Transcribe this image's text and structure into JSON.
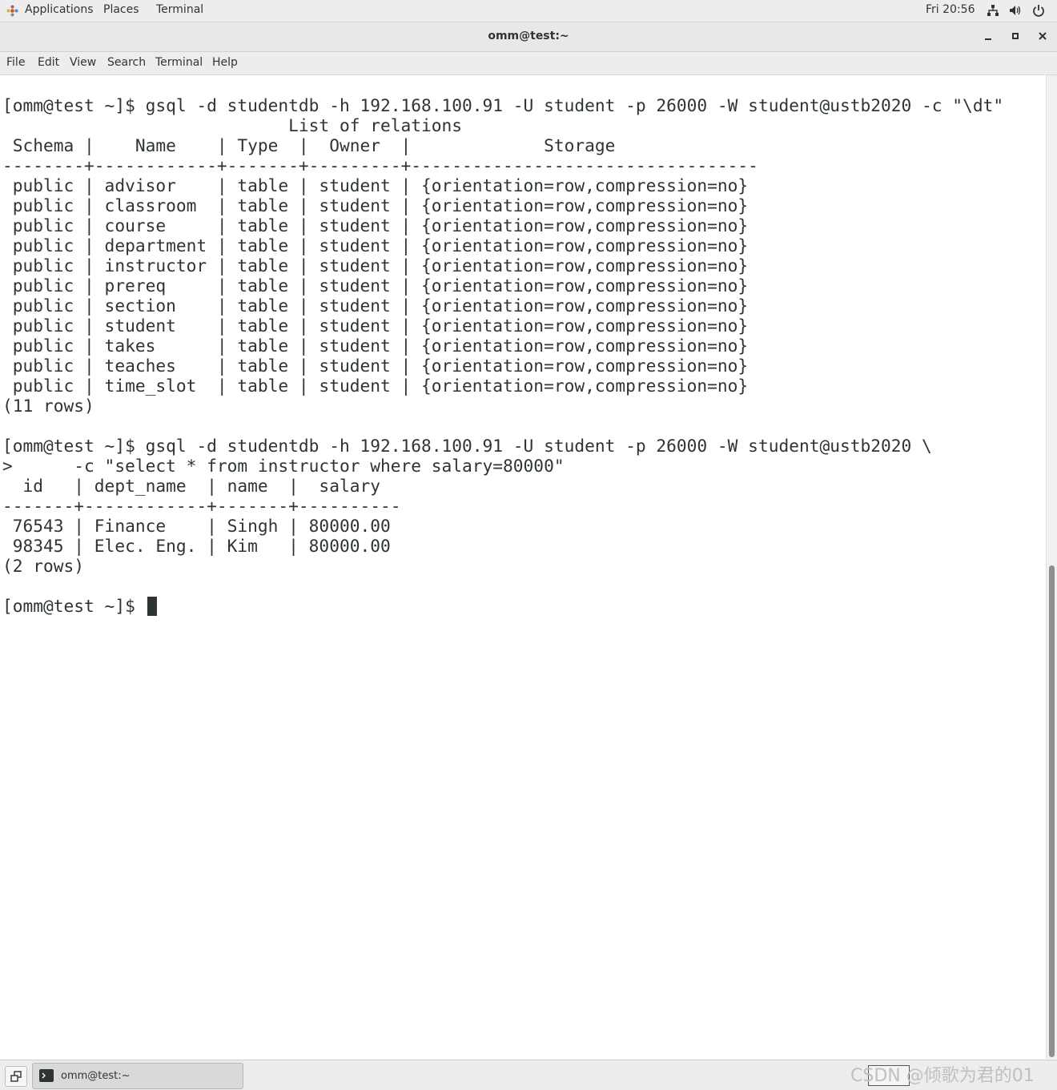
{
  "top_panel": {
    "applications": "Applications",
    "places": "Places",
    "terminal": "Terminal",
    "clock": "Fri 20:56",
    "icons": [
      "network-icon",
      "volume-icon",
      "power-icon"
    ]
  },
  "window": {
    "title": "omm@test:~",
    "buttons": [
      "minimize-icon",
      "maximize-icon",
      "close-icon"
    ]
  },
  "menubar": [
    "File",
    "Edit",
    "View",
    "Search",
    "Terminal",
    "Help"
  ],
  "terminal": {
    "lines": [
      "[omm@test ~]$ gsql -d studentdb -h 192.168.100.91 -U student -p 26000 -W student@ustb2020 -c \"\\dt\"",
      "                            List of relations",
      " Schema |    Name    | Type  |  Owner  |             Storage",
      "--------+------------+-------+---------+----------------------------------",
      " public | advisor    | table | student | {orientation=row,compression=no}",
      " public | classroom  | table | student | {orientation=row,compression=no}",
      " public | course     | table | student | {orientation=row,compression=no}",
      " public | department | table | student | {orientation=row,compression=no}",
      " public | instructor | table | student | {orientation=row,compression=no}",
      " public | prereq     | table | student | {orientation=row,compression=no}",
      " public | section    | table | student | {orientation=row,compression=no}",
      " public | student    | table | student | {orientation=row,compression=no}",
      " public | takes      | table | student | {orientation=row,compression=no}",
      " public | teaches    | table | student | {orientation=row,compression=no}",
      " public | time_slot  | table | student | {orientation=row,compression=no}",
      "(11 rows)",
      "",
      "[omm@test ~]$ gsql -d studentdb -h 192.168.100.91 -U student -p 26000 -W student@ustb2020 \\",
      ">      -c \"select * from instructor where salary=80000\"",
      "  id   | dept_name  | name  |  salary",
      "-------+------------+-------+----------",
      " 76543 | Finance    | Singh | 80000.00",
      " 98345 | Elec. Eng. | Kim   | 80000.00",
      "(2 rows)",
      "",
      "[omm@test ~]$ "
    ]
  },
  "taskbar": {
    "task_label": "omm@test:~",
    "watermark": "CSDN @倾歌为君的01"
  }
}
